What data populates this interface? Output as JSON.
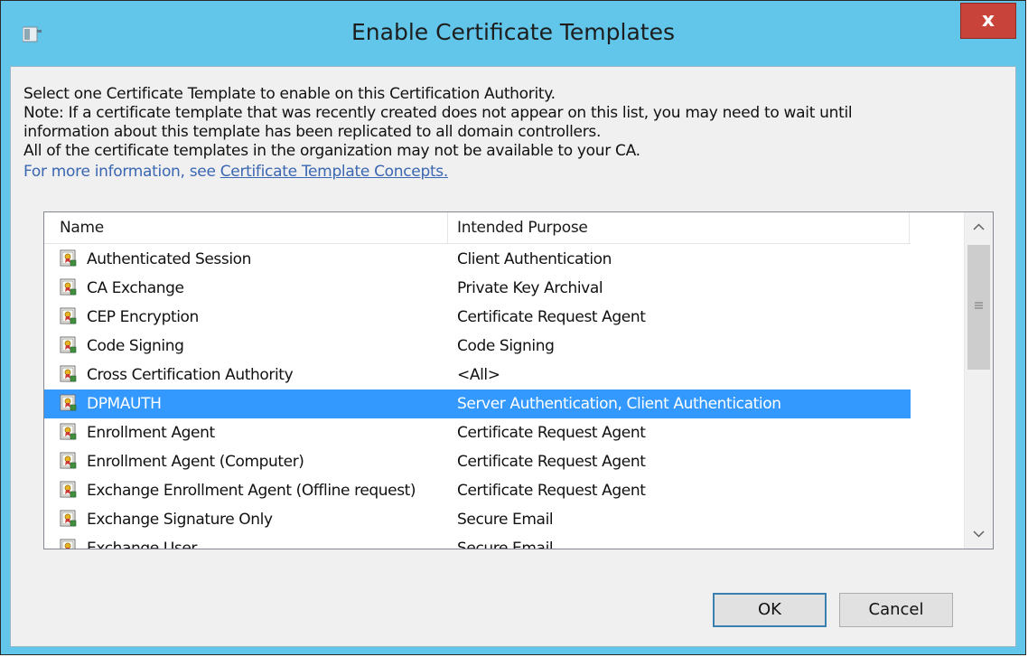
{
  "window": {
    "title": "Enable Certificate Templates",
    "close_label": "x"
  },
  "info": {
    "line1": "Select one Certificate Template to enable on this Certification Authority.",
    "line2": "Note: If a certificate template that was recently created does not appear on this list, you may need to wait until",
    "line3": "information about this template has been replicated to all domain controllers.",
    "line4": "All of the certificate templates in the organization may not be available to your CA.",
    "more_prefix": "For more information, see",
    "more_link": "Certificate Template Concepts."
  },
  "list": {
    "columns": [
      "Name",
      "Intended Purpose"
    ],
    "rows": [
      {
        "name": "Authenticated Session",
        "purpose": "Client Authentication"
      },
      {
        "name": "CA Exchange",
        "purpose": "Private Key Archival"
      },
      {
        "name": "CEP Encryption",
        "purpose": "Certificate Request Agent"
      },
      {
        "name": "Code Signing",
        "purpose": "Code Signing"
      },
      {
        "name": "Cross Certification Authority",
        "purpose": "<All>"
      },
      {
        "name": "DPMAUTH",
        "purpose": "Server Authentication, Client Authentication",
        "selected": true
      },
      {
        "name": "Enrollment Agent",
        "purpose": "Certificate Request Agent"
      },
      {
        "name": "Enrollment Agent (Computer)",
        "purpose": "Certificate Request Agent"
      },
      {
        "name": "Exchange Enrollment Agent (Offline request)",
        "purpose": "Certificate Request Agent"
      },
      {
        "name": "Exchange Signature Only",
        "purpose": "Secure Email"
      },
      {
        "name": "Exchange User",
        "purpose": "Secure Email"
      }
    ]
  },
  "buttons": {
    "ok": "OK",
    "cancel": "Cancel"
  },
  "colors": {
    "titlebar": "#61c6ea",
    "selection": "#3399ff",
    "close": "#c8443a",
    "link": "#3a66b2"
  }
}
